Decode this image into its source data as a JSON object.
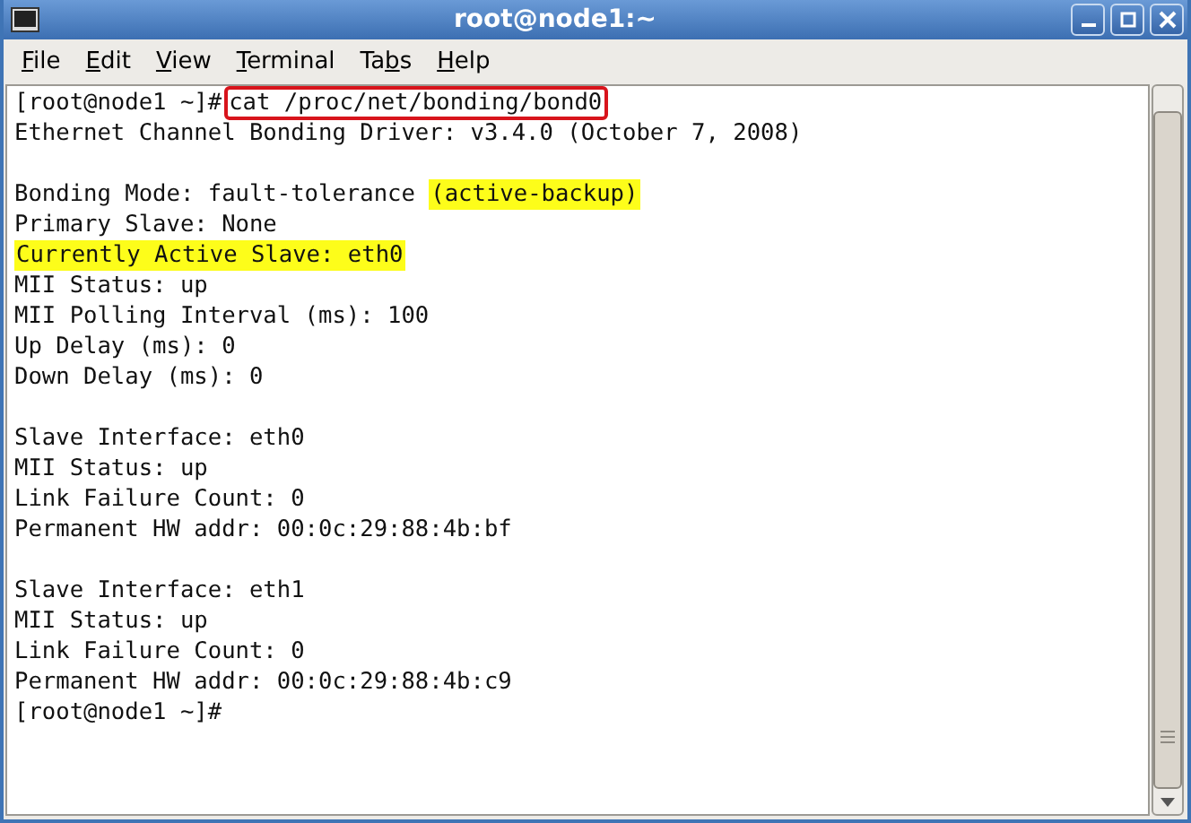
{
  "window": {
    "title": "root@node1:~"
  },
  "menu": [
    {
      "parts": [
        {
          "text": "F",
          "underlined": true
        },
        {
          "text": "ile",
          "underlined": false
        }
      ]
    },
    {
      "parts": [
        {
          "text": "E",
          "underlined": true
        },
        {
          "text": "dit",
          "underlined": false
        }
      ]
    },
    {
      "parts": [
        {
          "text": "V",
          "underlined": true
        },
        {
          "text": "iew",
          "underlined": false
        }
      ]
    },
    {
      "parts": [
        {
          "text": "T",
          "underlined": true
        },
        {
          "text": "erminal",
          "underlined": false
        }
      ]
    },
    {
      "parts": [
        {
          "text": "Ta",
          "underlined": false
        },
        {
          "text": "b",
          "underlined": true
        },
        {
          "text": "s",
          "underlined": false
        }
      ]
    },
    {
      "parts": [
        {
          "text": "H",
          "underlined": true
        },
        {
          "text": "elp",
          "underlined": false
        }
      ]
    }
  ],
  "terminal": {
    "lines": [
      {
        "kind": "text",
        "segments": [
          {
            "text": "[root@node1 ~]#",
            "boxed": false,
            "highlighted": false
          },
          {
            "text": "cat /proc/net/bonding/bond0",
            "boxed": true,
            "highlighted": false
          }
        ]
      },
      {
        "kind": "text",
        "segments": [
          {
            "text": "Ethernet Channel Bonding Driver: v3.4.0 (October 7, 2008)",
            "boxed": false,
            "highlighted": false
          }
        ]
      },
      {
        "kind": "blank"
      },
      {
        "kind": "text",
        "segments": [
          {
            "text": "Bonding Mode: fault-tolerance ",
            "boxed": false,
            "highlighted": false
          },
          {
            "text": "(active-backup)",
            "boxed": false,
            "highlighted": true
          }
        ]
      },
      {
        "kind": "text",
        "segments": [
          {
            "text": "Primary Slave: None",
            "boxed": false,
            "highlighted": false
          }
        ]
      },
      {
        "kind": "text",
        "segments": [
          {
            "text": "Currently Active Slave: eth0",
            "boxed": false,
            "highlighted": true
          }
        ]
      },
      {
        "kind": "text",
        "segments": [
          {
            "text": "MII Status: up",
            "boxed": false,
            "highlighted": false
          }
        ]
      },
      {
        "kind": "text",
        "segments": [
          {
            "text": "MII Polling Interval (ms): 100",
            "boxed": false,
            "highlighted": false
          }
        ]
      },
      {
        "kind": "text",
        "segments": [
          {
            "text": "Up Delay (ms): 0",
            "boxed": false,
            "highlighted": false
          }
        ]
      },
      {
        "kind": "text",
        "segments": [
          {
            "text": "Down Delay (ms): 0",
            "boxed": false,
            "highlighted": false
          }
        ]
      },
      {
        "kind": "blank"
      },
      {
        "kind": "text",
        "segments": [
          {
            "text": "Slave Interface: eth0",
            "boxed": false,
            "highlighted": false
          }
        ]
      },
      {
        "kind": "text",
        "segments": [
          {
            "text": "MII Status: up",
            "boxed": false,
            "highlighted": false
          }
        ]
      },
      {
        "kind": "text",
        "segments": [
          {
            "text": "Link Failure Count: 0",
            "boxed": false,
            "highlighted": false
          }
        ]
      },
      {
        "kind": "text",
        "segments": [
          {
            "text": "Permanent HW addr: 00:0c:29:88:4b:bf",
            "boxed": false,
            "highlighted": false
          }
        ]
      },
      {
        "kind": "blank"
      },
      {
        "kind": "text",
        "segments": [
          {
            "text": "Slave Interface: eth1",
            "boxed": false,
            "highlighted": false
          }
        ]
      },
      {
        "kind": "text",
        "segments": [
          {
            "text": "MII Status: up",
            "boxed": false,
            "highlighted": false
          }
        ]
      },
      {
        "kind": "text",
        "segments": [
          {
            "text": "Link Failure Count: 0",
            "boxed": false,
            "highlighted": false
          }
        ]
      },
      {
        "kind": "text",
        "segments": [
          {
            "text": "Permanent HW addr: 00:0c:29:88:4b:c9",
            "boxed": false,
            "highlighted": false
          }
        ]
      },
      {
        "kind": "text",
        "segments": [
          {
            "text": "[root@node1 ~]#",
            "boxed": false,
            "highlighted": false
          }
        ]
      }
    ]
  }
}
